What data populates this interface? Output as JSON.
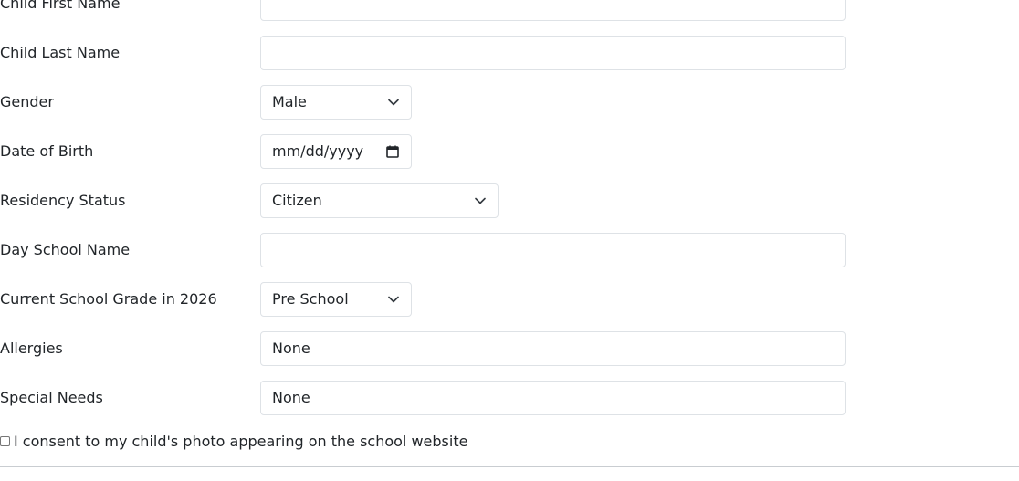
{
  "form": {
    "child_first_name": {
      "label": "Child First Name",
      "value": ""
    },
    "child_last_name": {
      "label": "Child Last Name",
      "value": ""
    },
    "gender": {
      "label": "Gender",
      "selected": "Male"
    },
    "date_of_birth": {
      "label": "Date of Birth",
      "placeholder": "mm/dd/yyyy"
    },
    "residency_status": {
      "label": "Residency Status",
      "selected": "Citizen"
    },
    "day_school_name": {
      "label": "Day School Name",
      "value": ""
    },
    "current_grade": {
      "label": "Current School Grade in 2026",
      "selected": "Pre School"
    },
    "allergies": {
      "label": "Allergies",
      "value": "None"
    },
    "special_needs": {
      "label": "Special Needs",
      "value": "None"
    },
    "photo_consent": {
      "label": "I consent to my child's photo appearing on the school website",
      "checked": false
    }
  },
  "icons": {
    "select_arrow": "chevron-down-icon",
    "date_picker": "calendar-icon"
  },
  "colors": {
    "border": "#dee2e6",
    "text": "#212529"
  }
}
